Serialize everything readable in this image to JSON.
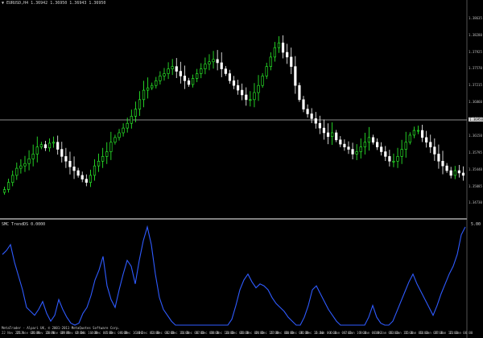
{
  "window": {
    "symbol_line": "▼ EURUSD,H4  1.36942  1.36950  1.36943  1.36950"
  },
  "indicator": {
    "label": "SMC TrendDS 0.0000",
    "max_label": "5.00"
  },
  "footer": {
    "label": "MetaTrader - Alpari UK, © 2001-2011 MetaQuotes Software Corp."
  },
  "colors": {
    "background": "#000000",
    "bull_candle": "#2dff2d",
    "bear_candle": "#ffffff",
    "indicator_line": "#2f5bff",
    "separator": "#ffffff",
    "price_line": "#bdbdbd"
  },
  "price_axis": {
    "ticks": [
      "1.38635",
      "1.38280",
      "1.37925",
      "1.37570",
      "1.37215",
      "1.36860",
      "1.36505",
      "1.36150",
      "1.35795",
      "1.35440",
      "1.35085",
      "1.34730"
    ],
    "current_price": "1.36950"
  },
  "dates": [
    "22 Nov 2013",
    "25 Nov 08:00",
    "26 Nov 16:00",
    "28 Nov 00:00",
    "29 Nov 08:00",
    "2 Dec 16:00",
    "4 Dec 00:00",
    "5 Dec 08:00",
    "6 Dec 16:00",
    "10 Dec 00:00",
    "11 Dec 08:00",
    "12 Dec 16:00",
    "16 Dec 00:00",
    "17 Dec 08:00",
    "18 Dec 16:00",
    "20 Dec 00:00",
    "23 Dec 08:00",
    "24 Dec 16:00",
    "27 Dec 00:00",
    "30 Dec 08:00",
    "31 Dec 16:00",
    "3 Jan 00:00",
    "6 Jan 08:00",
    "7 Jan 16:00",
    "9 Jan 00:00",
    "10 Jan 08:00",
    "13 Jan 16:00",
    "15 Jan 00:00",
    "16 Jan 08:00",
    "17 Jan 16:00",
    "21 Jan 00:00"
  ],
  "chart_data": [
    {
      "type": "candlestick",
      "symbol": "EURUSD",
      "timeframe": "H4",
      "ylim": [
        1.3455,
        1.387
      ],
      "closes": [
        1.35,
        1.3515,
        1.353,
        1.3545,
        1.355,
        1.3555,
        1.3565,
        1.3575,
        1.359,
        1.3595,
        1.3588,
        1.3598,
        1.36,
        1.3585,
        1.357,
        1.356,
        1.3548,
        1.354,
        1.353,
        1.3522,
        1.3515,
        1.353,
        1.355,
        1.356,
        1.357,
        1.358,
        1.36,
        1.361,
        1.362,
        1.363,
        1.364,
        1.3655,
        1.367,
        1.369,
        1.371,
        1.3715,
        1.372,
        1.373,
        1.374,
        1.3745,
        1.3755,
        1.376,
        1.375,
        1.374,
        1.373,
        1.3722,
        1.3735,
        1.3745,
        1.3755,
        1.3765,
        1.377,
        1.3775,
        1.3768,
        1.3755,
        1.3745,
        1.373,
        1.372,
        1.371,
        1.37,
        1.369,
        1.369,
        1.3705,
        1.372,
        1.374,
        1.376,
        1.378,
        1.38,
        1.381,
        1.379,
        1.378,
        1.376,
        1.372,
        1.369,
        1.367,
        1.366,
        1.365,
        1.364,
        1.363,
        1.362,
        1.3612,
        1.362,
        1.3605,
        1.3596,
        1.359,
        1.3585,
        1.3575,
        1.358,
        1.359,
        1.36,
        1.361,
        1.36,
        1.359,
        1.358,
        1.357,
        1.356,
        1.356,
        1.357,
        1.3585,
        1.36,
        1.3615,
        1.3625,
        1.3625,
        1.361,
        1.36,
        1.359,
        1.3575,
        1.356,
        1.355,
        1.354,
        1.353,
        1.354,
        1.3535,
        1.353
      ]
    },
    {
      "type": "line",
      "name": "SMC TrendDS",
      "ylim": [
        0,
        5
      ],
      "values": [
        3.6,
        3.8,
        4.1,
        3.2,
        2.5,
        1.8,
        0.9,
        0.7,
        0.5,
        0.8,
        1.2,
        0.6,
        0.2,
        0.5,
        1.3,
        0.8,
        0.4,
        0.1,
        0.0,
        0.1,
        0.6,
        0.9,
        1.5,
        2.3,
        2.8,
        3.5,
        2.0,
        1.3,
        0.9,
        1.8,
        2.6,
        3.3,
        3.0,
        2.1,
        3.3,
        4.3,
        5.0,
        4.1,
        2.6,
        1.4,
        0.8,
        0.5,
        0.2,
        0.0,
        0.0,
        0.0,
        0.0,
        0.0,
        0.0,
        0.0,
        0.0,
        0.0,
        0.0,
        0.0,
        0.0,
        0.0,
        0.0,
        0.3,
        1.0,
        1.8,
        2.3,
        2.6,
        2.2,
        1.9,
        2.1,
        2.0,
        1.8,
        1.4,
        1.1,
        0.9,
        0.7,
        0.4,
        0.2,
        0.0,
        0.0,
        0.4,
        1.0,
        1.8,
        2.0,
        1.6,
        1.2,
        0.8,
        0.5,
        0.2,
        0.0,
        0.0,
        0.0,
        0.0,
        0.0,
        0.0,
        0.0,
        0.4,
        1.0,
        0.4,
        0.1,
        0.0,
        0.0,
        0.2,
        0.7,
        1.2,
        1.7,
        2.2,
        2.6,
        2.1,
        1.7,
        1.3,
        0.9,
        0.5,
        1.0,
        1.6,
        2.1,
        2.6,
        3.0,
        3.6,
        4.6,
        5.0
      ]
    }
  ]
}
